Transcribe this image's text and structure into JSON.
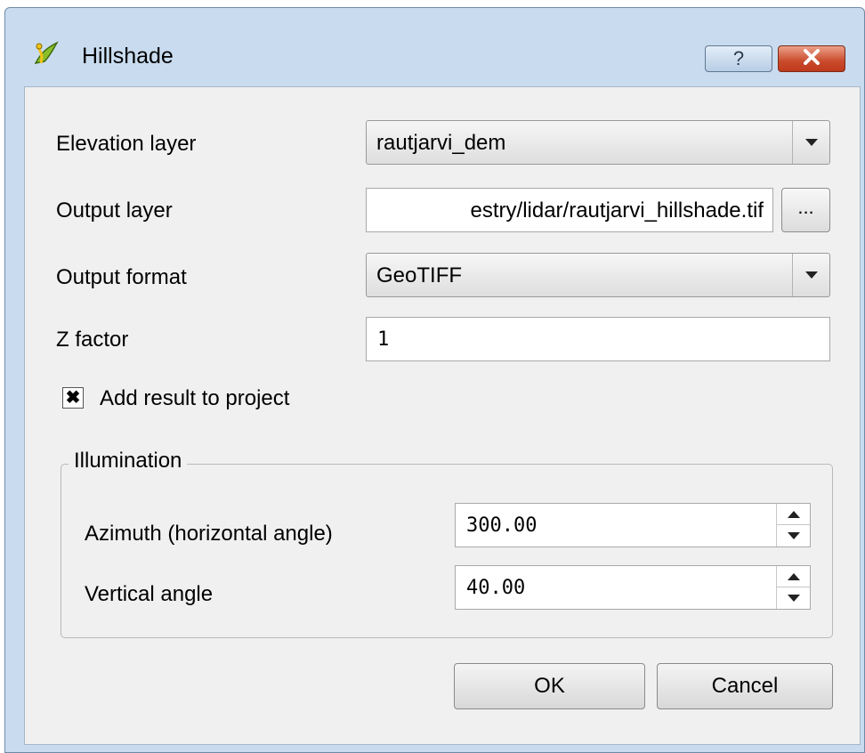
{
  "window": {
    "title": "Hillshade",
    "help_label": "?",
    "icon": "qgis-icon",
    "close_icon": "close-icon"
  },
  "form": {
    "elevation_layer": {
      "label": "Elevation layer",
      "value": "rautjarvi_dem"
    },
    "output_layer": {
      "label": "Output layer",
      "value": "estry/lidar/rautjarvi_hillshade.tif",
      "browse_label": "..."
    },
    "output_format": {
      "label": "Output format",
      "value": "GeoTIFF"
    },
    "z_factor": {
      "label": "Z factor",
      "value": "1"
    },
    "add_result": {
      "label": "Add result to project",
      "checked": true
    }
  },
  "illumination": {
    "title": "Illumination",
    "azimuth": {
      "label": "Azimuth (horizontal angle)",
      "value": "300.00"
    },
    "vertical": {
      "label": "Vertical angle",
      "value": "40.00"
    }
  },
  "buttons": {
    "ok": "OK",
    "cancel": "Cancel"
  },
  "colors": {
    "window_frame": "#c9dcef",
    "client_bg": "#f0f0f0",
    "close_button": "#c94b2c"
  }
}
